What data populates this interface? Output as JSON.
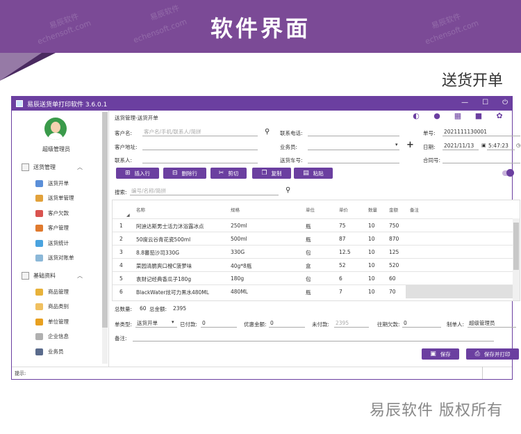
{
  "banner": {
    "title": "软件界面",
    "watermark_cn": "易辰软件",
    "watermark_en": "echensoft.com"
  },
  "section_title": "送货开单",
  "window": {
    "title": "易辰送货单打印软件 3.6.0.1",
    "min": "—",
    "max": "☐",
    "close": "⏻"
  },
  "sidebar": {
    "user": "超级管理员",
    "groups": [
      {
        "label": "送货管理",
        "chev": "︿"
      },
      {
        "label": "基础资料",
        "chev": "︿"
      }
    ],
    "items1": [
      "送货开单",
      "送货单管理",
      "客户欠款",
      "客户管理",
      "送货统计",
      "送货对账单"
    ],
    "items2": [
      "商品管理",
      "商品类别",
      "单位管理",
      "企业信息",
      "业务员"
    ]
  },
  "breadcrumb": "送货管理-送货开单",
  "form": {
    "customer_label": "客户名:",
    "customer_placeholder": "客户名/手机/联系人/简拼",
    "address_label": "客户地址:",
    "address_value": "",
    "contact_label": "联系人:",
    "contact_value": "",
    "phone_label": "联系电话:",
    "phone_value": "",
    "salesman_label": "业务员:",
    "salesman_value": "",
    "car_label": "送货车号:",
    "car_value": "",
    "no_label": "单号:",
    "no_value": "2021111130001",
    "date_label": "日期:",
    "date_value": "2021/11/13",
    "time_value": "5:47:23",
    "contract_label": "合同号:",
    "contract_value": ""
  },
  "buttons": {
    "insert": "插入行",
    "delete": "删除行",
    "cut": "剪切",
    "copy": "复制",
    "paste": "粘贴",
    "save": "保存",
    "save_print": "保存并打印"
  },
  "search": {
    "label": "搜索:",
    "placeholder": "编号/名称/简拼"
  },
  "table": {
    "headers": [
      "名称",
      "规格",
      "单位",
      "单价",
      "数量",
      "金额",
      "备注"
    ],
    "rows": [
      [
        "1",
        "阿迪达斯男士活力沐浴露冰点",
        "250ml",
        "瓶",
        "75",
        "10",
        "750"
      ],
      [
        "2",
        "50度云谷青花瓷500ml",
        "500ml",
        "瓶",
        "87",
        "10",
        "870"
      ],
      [
        "3",
        "8.8蕃茄沙司330G",
        "330G",
        "包",
        "12.5",
        "10",
        "125"
      ],
      [
        "4",
        "菜园清脆爽口橙C菠萝味",
        "40g*8瓶",
        "盒",
        "52",
        "10",
        "520"
      ],
      [
        "5",
        "袁财记经典香瓜子180g",
        "180g",
        "包",
        "6",
        "10",
        "60"
      ],
      [
        "6",
        "BlackWater炫可力黑水480ML",
        "480ML",
        "瓶",
        "7",
        "10",
        "70"
      ]
    ]
  },
  "summary": {
    "qty_label": "总数量:",
    "qty": "60",
    "amount_label": "总金额:",
    "amount": "2395"
  },
  "bottom": {
    "type_label": "单类型:",
    "type_value": "送货开单",
    "paid_label": "已付款:",
    "paid_value": "0",
    "discount_label": "优惠金额:",
    "discount_value": "0",
    "unpaid_label": "未付款:",
    "unpaid_value": "2395",
    "prev_debt_label": "往期欠款:",
    "prev_debt_value": "0",
    "maker_label": "制单人:",
    "maker_value": "超级管理员",
    "remark_label": "备注:"
  },
  "status": "提示:",
  "footer": "易辰软件 版权所有",
  "colors": {
    "accent": "#6b3fa0",
    "banner": "#7b4a96"
  }
}
